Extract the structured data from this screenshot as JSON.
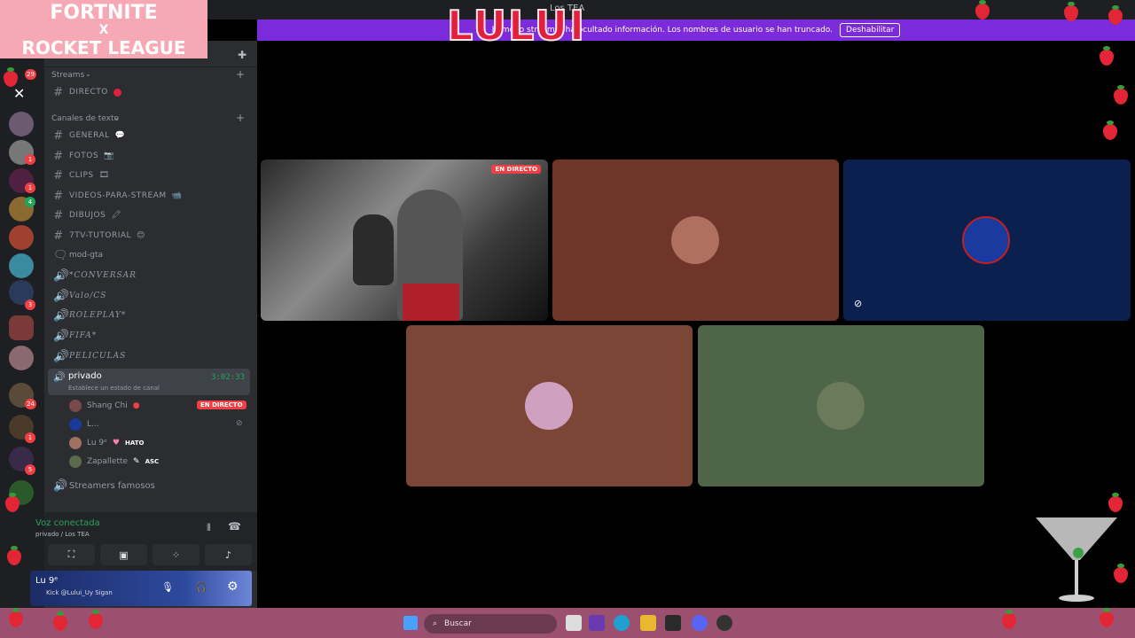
{
  "window": {
    "title": "Los TEA"
  },
  "overlay": {
    "banner_top": "FORTNITE",
    "banner_mid": "X",
    "banner_bottom": "ROCKET LEAGUE",
    "logo_text": "LULUI"
  },
  "streamer_bar": {
    "message": "El modo streamer ha ocultado información. Los nombres de usuario se han truncado.",
    "button": "Deshabilitar"
  },
  "guilds": {
    "badges": [
      "29",
      "1",
      "1",
      "4",
      "3",
      "24",
      "1",
      "5"
    ]
  },
  "channels": {
    "categories": [
      {
        "label": "Streams"
      },
      {
        "label": "Canales de texto"
      }
    ],
    "streams": [
      {
        "label": "DIRECTO"
      }
    ],
    "text": [
      {
        "label": "GENERAL"
      },
      {
        "label": "FOTOS"
      },
      {
        "label": "CLIPS"
      },
      {
        "label": "VIDEOS-PARA-STREAM"
      },
      {
        "label": "DIBUJOS"
      },
      {
        "label": "7TV-TUTORIAL"
      },
      {
        "label": "mod-gta"
      },
      {
        "label": "*CONVERSAR"
      },
      {
        "label": "Valo/CS"
      },
      {
        "label": "ROLEPLAY*"
      },
      {
        "label": "FIFA*"
      },
      {
        "label": "PELICULAS"
      }
    ],
    "voice_active": {
      "name": "privado",
      "status": "Establece un estado de canal",
      "timer": "3:02:33",
      "members": [
        {
          "name": "Shang Chi",
          "tag": "",
          "live": "EN DIRECTO"
        },
        {
          "name": "L...",
          "tag": "",
          "live": ""
        },
        {
          "name": "Lu 9ᵉ",
          "tag": "HATO",
          "live": ""
        },
        {
          "name": "Zapallette",
          "tag": "ASC",
          "live": ""
        }
      ]
    },
    "voice_other": {
      "name": "Streamers famosos"
    }
  },
  "voice_panel": {
    "status": "Voz conectada",
    "channel": "privado / Los TEA"
  },
  "user_panel": {
    "name": "Lu 9ᵉ",
    "status": "Kick @Lului_Uy Sigan"
  },
  "stage": {
    "live_label": "EN DIRECTO",
    "tiles": [
      {
        "bg": "#6b6b6b"
      },
      {
        "bg": "#6e3528"
      },
      {
        "bg": "#0c2050"
      },
      {
        "bg": "#7b4636"
      },
      {
        "bg": "#4e6647"
      }
    ]
  },
  "taskbar": {
    "search_label": "Buscar"
  },
  "colors": {
    "accent": "#7b2bd9",
    "online": "#23a559",
    "danger": "#f23f43"
  }
}
